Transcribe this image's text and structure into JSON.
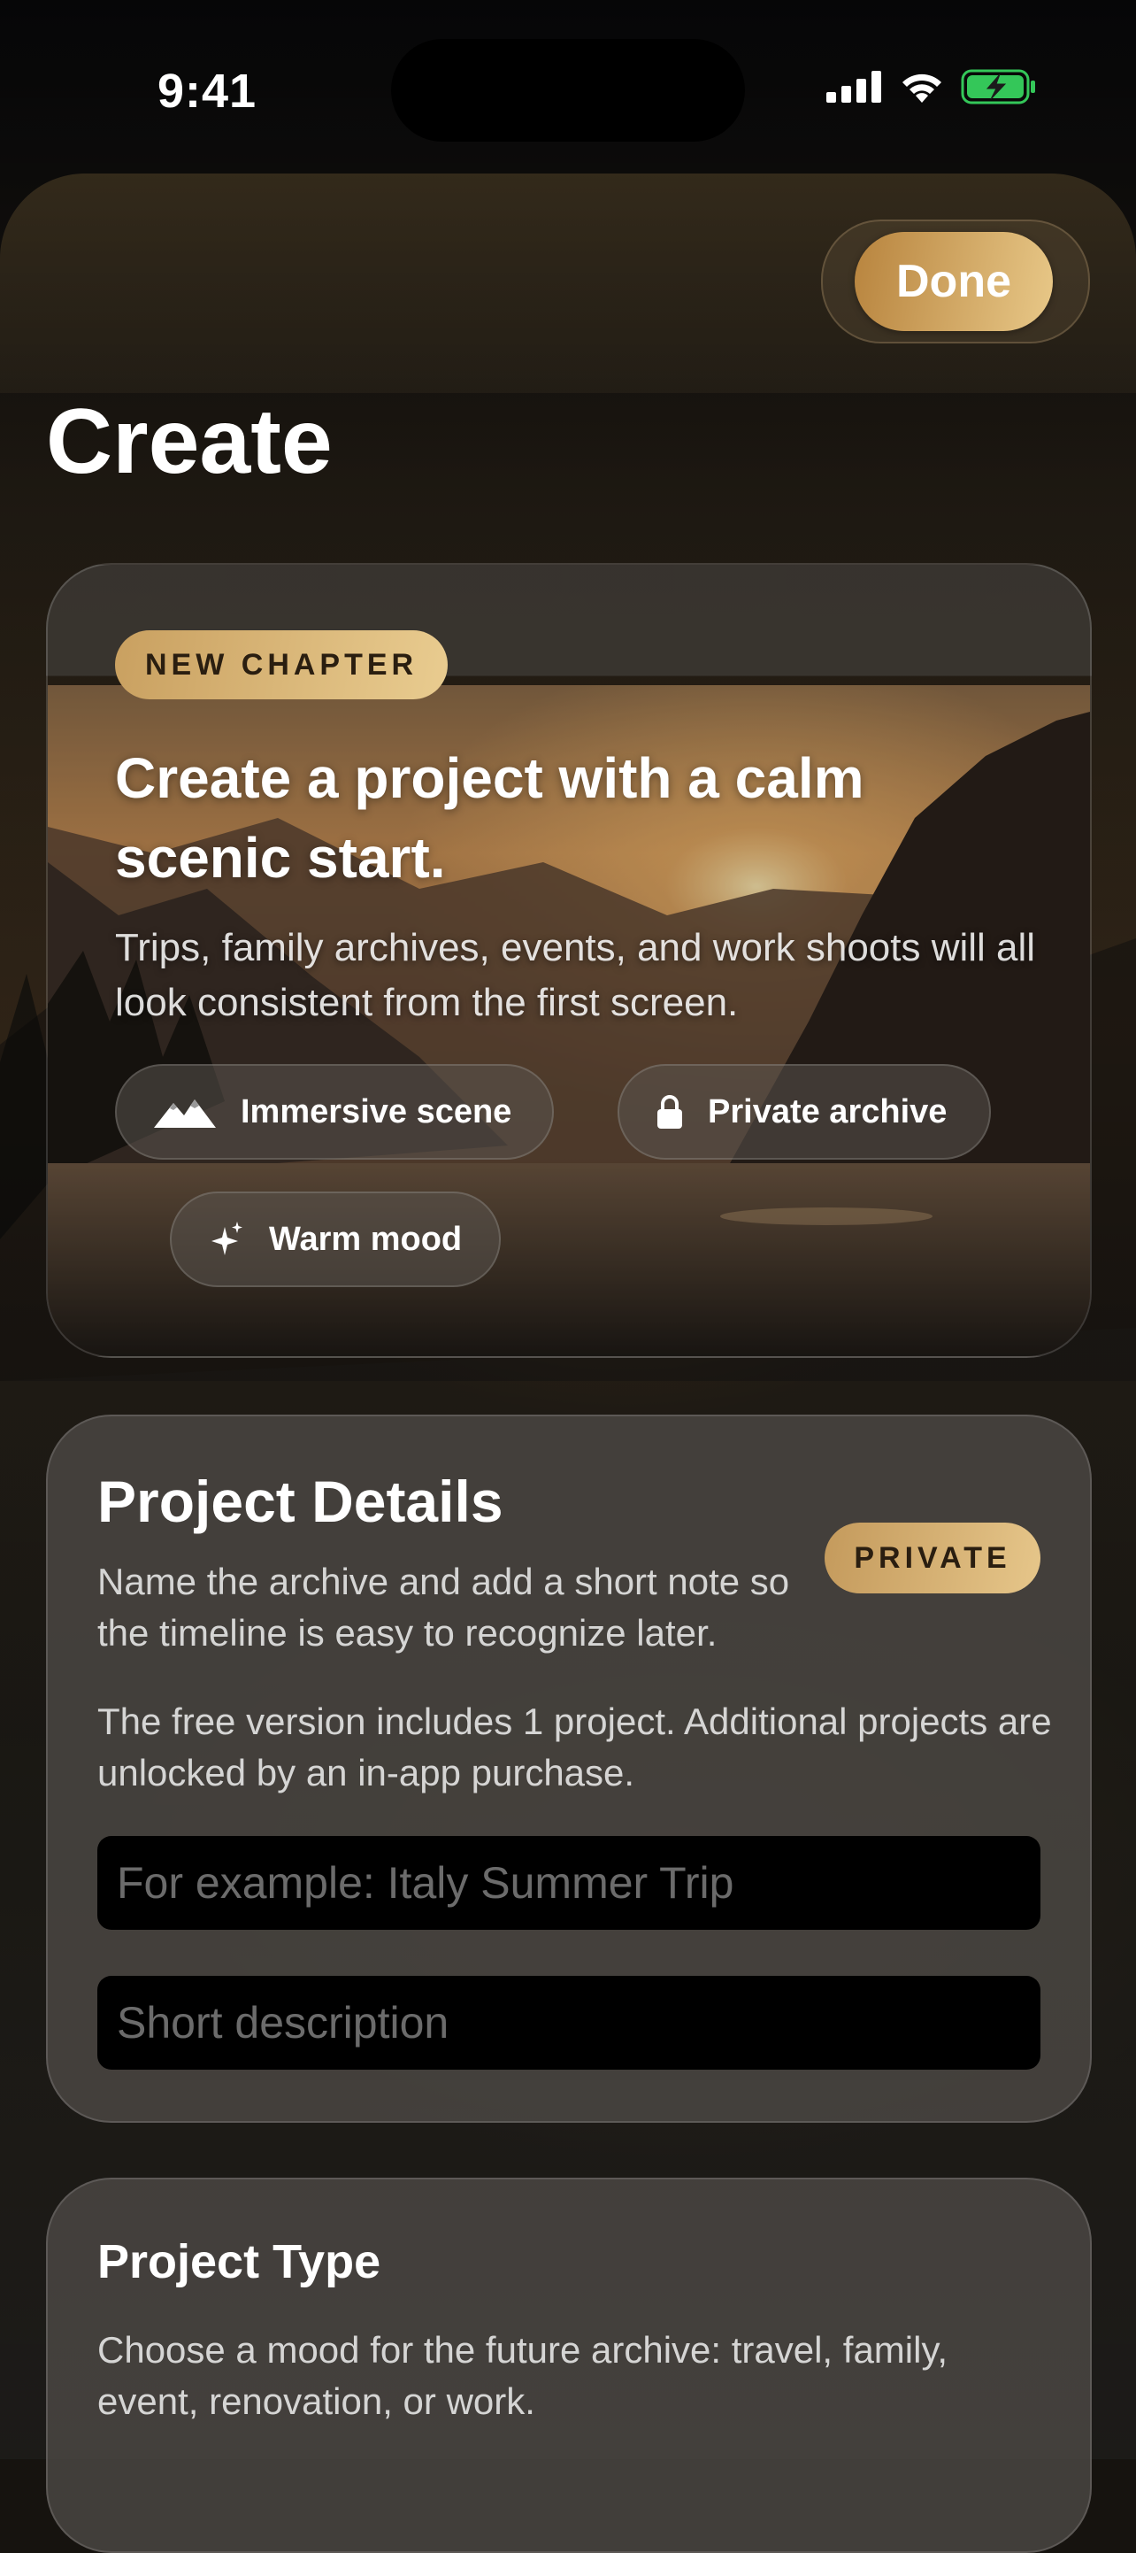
{
  "status_bar": {
    "time": "9:41"
  },
  "header": {
    "done_label": "Done",
    "title": "Create"
  },
  "hero": {
    "badge": "NEW CHAPTER",
    "title": "Create a project with a calm scenic start.",
    "subtitle": "Trips, family archives, events, and work shoots will all look consistent from the first screen.",
    "chips": [
      {
        "label": "Immersive scene",
        "icon": "mountains-icon"
      },
      {
        "label": "Private archive",
        "icon": "lock-icon"
      },
      {
        "label": "Warm mood",
        "icon": "sparkles-icon"
      }
    ]
  },
  "details": {
    "title": "Project Details",
    "badge": "PRIVATE",
    "description": "Name the archive and add a short note so the timeline is easy to recognize later.",
    "note": "The free version includes 1 project. Additional projects are unlocked by an in-app purchase.",
    "name_placeholder": "For example: Italy Summer Trip",
    "name_value": "",
    "desc_placeholder": "Short description",
    "desc_value": ""
  },
  "project_type": {
    "title": "Project Type",
    "description": "Choose a mood for the future archive: travel, family, event, renovation, or work."
  },
  "colors": {
    "accent_gold": "#d9b173",
    "battery_green": "#34c759"
  }
}
